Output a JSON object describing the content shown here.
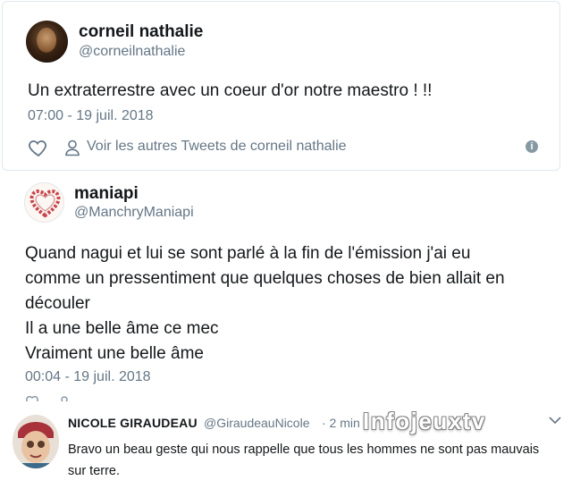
{
  "tweet1": {
    "name": "corneil nathalie",
    "handle": "@corneilnathalie",
    "text": "Un extraterrestre avec un coeur d'or notre maestro ! !!",
    "time": "07:00 - 19 juil. 2018",
    "more_link": "Voir les autres Tweets de corneil nathalie",
    "icons": [
      "heart-icon",
      "user-icon",
      "info-icon"
    ]
  },
  "tweet2": {
    "name": "maniapi",
    "handle": "@ManchryManiapi",
    "lines": [
      "Quand nagui et lui se sont parlé à la fin de l'émission j'ai eu",
      "comme un pressentiment que quelques choses de bien allait en",
      "découler",
      "Il a une belle âme ce mec",
      "Vraiment une belle âme"
    ],
    "time": "00:04 - 19 juil. 2018"
  },
  "comment": {
    "name": "NICOLE GIRAUDEAU",
    "handle": "@GiraudeauNicole",
    "time": "· 2 min",
    "lines": [
      "Bravo un beau geste qui nous rappelle que tous les hommes ne sont pas mauvais",
      "sur terre."
    ]
  },
  "watermark": "Infojeuxtv",
  "colors": {
    "text": "#14171a",
    "secondary": "#657786",
    "border": "#e1e8ed",
    "icon": "#8899a6"
  }
}
